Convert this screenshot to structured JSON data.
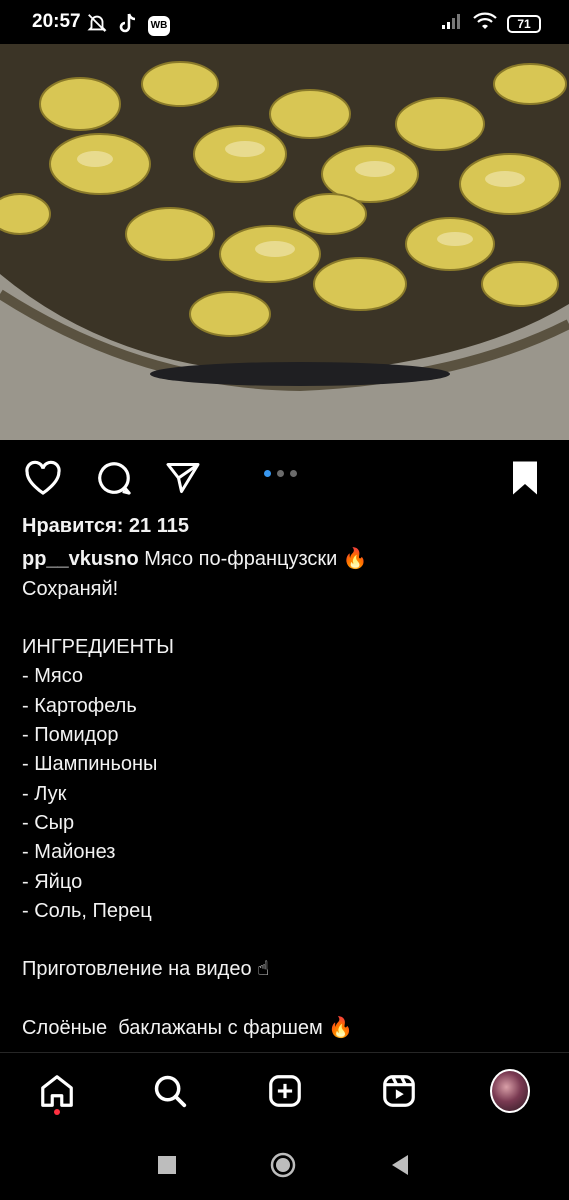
{
  "status_bar": {
    "time": "20:57",
    "wb_label": "WB",
    "battery": "71"
  },
  "post": {
    "likes": "Нравится: 21 115",
    "username": "pp__vkusno",
    "caption_lines": [
      "Мясо по-французски 🔥",
      "Сохраняй!",
      "",
      "ИНГРЕДИЕНТЫ",
      "- Мясо",
      "- Картофель",
      "- Помидор",
      "- Шампиньоны",
      "- Лук",
      "- Сыр",
      "- Майонез",
      "- Яйцо",
      "- Соль, Перец",
      "",
      "Приготовление на видео ☝",
      "",
      "Слоёные  баклажаны с фаршем 🔥"
    ],
    "carousel": {
      "pages": 3,
      "active": 1
    }
  },
  "colors": {
    "background": "#000000",
    "carousel_active": "#3897f0",
    "notification_dot": "#ff3040"
  },
  "icons": {
    "like": "heart-icon",
    "comment": "comment-icon",
    "share": "send-icon",
    "save": "bookmark-icon",
    "nav": [
      "home-icon",
      "search-icon",
      "create-icon",
      "reels-icon",
      "profile-avatar"
    ]
  }
}
